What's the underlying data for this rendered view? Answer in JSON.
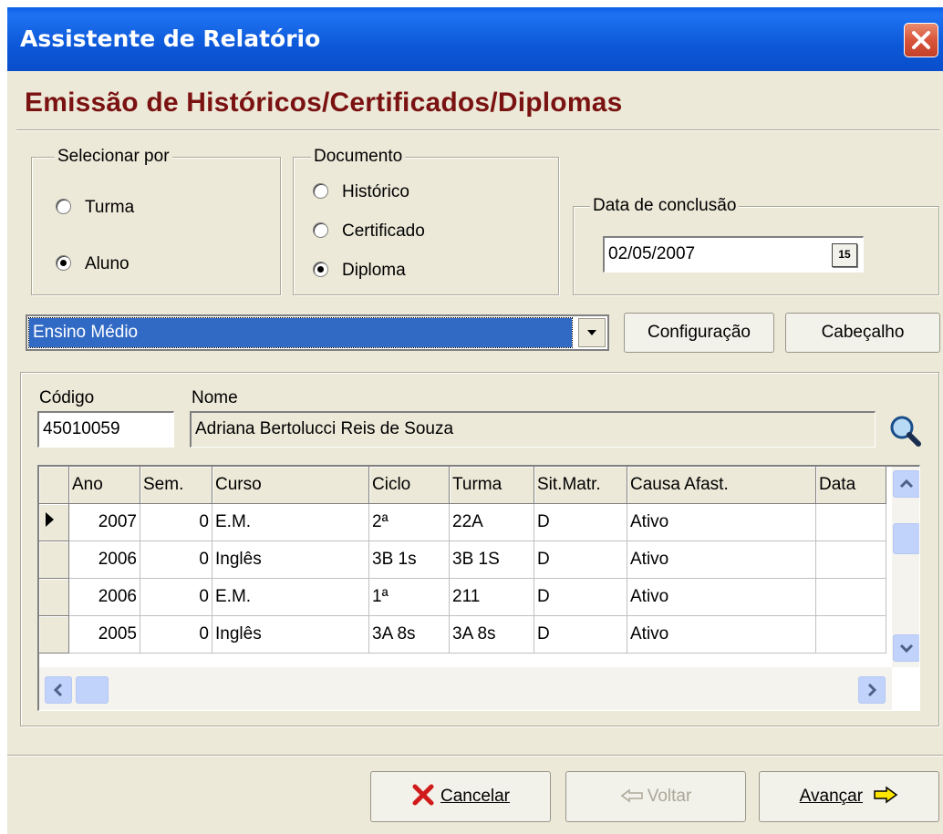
{
  "window": {
    "title": "Assistente de Relatório",
    "heading": "Emissão de Históricos/Certificados/Diplomas"
  },
  "select_by": {
    "legend": "Selecionar por",
    "options": [
      "Turma",
      "Aluno"
    ],
    "selected": "Aluno"
  },
  "document": {
    "legend": "Documento",
    "options": [
      "Histórico",
      "Certificado",
      "Diploma"
    ],
    "selected": "Diploma"
  },
  "conclusion": {
    "legend": "Data de conclusão",
    "value": "02/05/2007",
    "calendar_icon_text": "15"
  },
  "level_combo": {
    "value": "Ensino Médio"
  },
  "buttons": {
    "config": "Configuração",
    "header": "Cabeçalho",
    "cancel": "Cancelar",
    "back": "Voltar",
    "next": "Avançar"
  },
  "student": {
    "code_label": "Código",
    "code": "45010059",
    "name_label": "Nome",
    "name": "Adriana Bertolucci Reis de Souza"
  },
  "grid": {
    "columns": [
      "Ano",
      "Sem.",
      "Curso",
      "Ciclo",
      "Turma",
      "Sit.Matr.",
      "Causa Afast.",
      "Data"
    ],
    "rows": [
      [
        "2007",
        "0",
        "E.M.",
        "2ª",
        "22A",
        "D",
        "Ativo",
        ""
      ],
      [
        "2006",
        "0",
        "Inglês",
        "3B 1s",
        "3B 1S",
        "D",
        "Ativo",
        ""
      ],
      [
        "2006",
        "0",
        "E.M.",
        "1ª",
        "211",
        "D",
        "Ativo",
        ""
      ],
      [
        "2005",
        "0",
        "Inglês",
        "3A 8s",
        "3A 8s",
        "D",
        "Ativo",
        ""
      ]
    ]
  },
  "colors": {
    "title_bar": "#0A5FE6",
    "heading": "#7B1212",
    "selection": "#316AC5",
    "dialog_bg": "#ECE9D8"
  }
}
